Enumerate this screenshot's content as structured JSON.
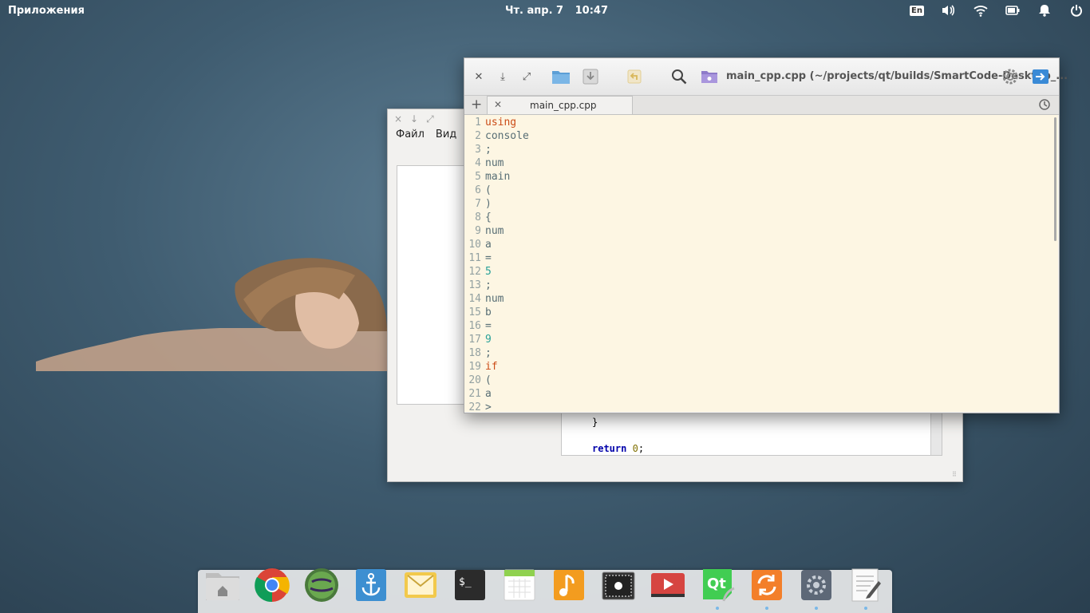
{
  "panel": {
    "apps_label": "Приложения",
    "date": "Чт. апр. 7",
    "time": "10:47",
    "keyboard_layout": "En",
    "indicators": [
      "volume-icon",
      "wifi-icon",
      "battery-icon",
      "notification-bell-icon",
      "power-icon"
    ]
  },
  "back_window": {
    "menu": [
      "Файл",
      "Вид"
    ],
    "code_line1": "}",
    "code_line2_keyword": "return",
    "code_line2_number": "0",
    "code_line2_end": ";"
  },
  "editor": {
    "title": "main_cpp.cpp (~/projects/qt/builds/SmartCode-Desktop_...",
    "tab_label": "main_cpp.cpp",
    "lines": [
      {
        "n": "1",
        "text": "using",
        "kind": "kw"
      },
      {
        "n": "2",
        "text": "console",
        "kind": "id"
      },
      {
        "n": "3",
        "text": ";",
        "kind": "id"
      },
      {
        "n": "4",
        "text": "num",
        "kind": "id"
      },
      {
        "n": "5",
        "text": "main",
        "kind": "id"
      },
      {
        "n": "6",
        "text": "(",
        "kind": "id"
      },
      {
        "n": "7",
        "text": ")",
        "kind": "id"
      },
      {
        "n": "8",
        "text": "{",
        "kind": "id"
      },
      {
        "n": "9",
        "text": "num",
        "kind": "id"
      },
      {
        "n": "10",
        "text": "a",
        "kind": "id"
      },
      {
        "n": "11",
        "text": "=",
        "kind": "id"
      },
      {
        "n": "12",
        "text": "5",
        "kind": "num"
      },
      {
        "n": "13",
        "text": ";",
        "kind": "id"
      },
      {
        "n": "14",
        "text": "num",
        "kind": "id"
      },
      {
        "n": "15",
        "text": "b",
        "kind": "id"
      },
      {
        "n": "16",
        "text": "=",
        "kind": "id"
      },
      {
        "n": "17",
        "text": "9",
        "kind": "num"
      },
      {
        "n": "18",
        "text": ";",
        "kind": "id"
      },
      {
        "n": "19",
        "text": "if",
        "kind": "kw"
      },
      {
        "n": "20",
        "text": "(",
        "kind": "id"
      },
      {
        "n": "21",
        "text": "a",
        "kind": "id"
      },
      {
        "n": "22",
        "text": ">",
        "kind": "id"
      }
    ],
    "colors": {
      "background": "#fdf6e3",
      "keyword": "#cb4b16",
      "number": "#2aa198",
      "text": "#586e75"
    }
  },
  "dock": {
    "apps": [
      {
        "name": "files",
        "running": false
      },
      {
        "name": "chrome",
        "running": false
      },
      {
        "name": "tor-browser",
        "running": false
      },
      {
        "name": "anchor-app",
        "running": false
      },
      {
        "name": "mail",
        "running": false
      },
      {
        "name": "terminal",
        "running": false
      },
      {
        "name": "calendar",
        "running": false
      },
      {
        "name": "music",
        "running": false
      },
      {
        "name": "screenshot",
        "running": false
      },
      {
        "name": "video",
        "running": false
      },
      {
        "name": "qt-creator",
        "running": true
      },
      {
        "name": "updater",
        "running": true
      },
      {
        "name": "settings",
        "running": true
      },
      {
        "name": "text-editor",
        "running": true
      }
    ]
  }
}
